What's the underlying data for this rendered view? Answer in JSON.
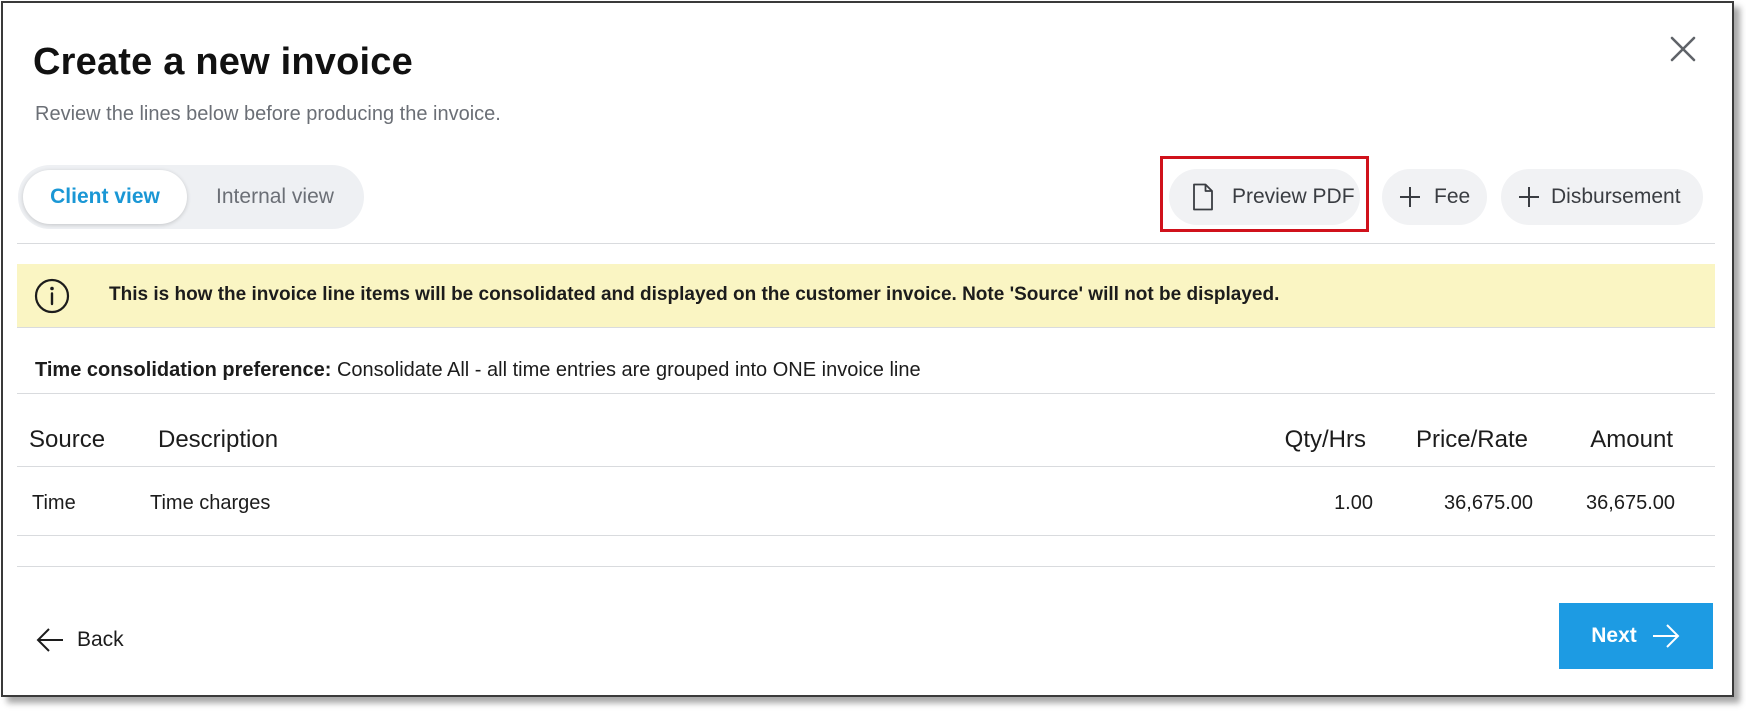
{
  "dialog": {
    "title": "Create a new invoice",
    "subtitle": "Review the lines below before producing the invoice."
  },
  "view_toggle": {
    "options": [
      {
        "label": "Client view",
        "selected": true
      },
      {
        "label": "Internal view",
        "selected": false
      }
    ]
  },
  "actions": {
    "preview_pdf": "Preview PDF",
    "fee": "Fee",
    "disbursement": "Disbursement"
  },
  "banner": {
    "text": "This is how the invoice line items will be consolidated and displayed on the customer invoice. Note 'Source' will not be displayed.",
    "icon": "info-icon",
    "color": "#faf5c3"
  },
  "preference": {
    "label": "Time consolidation preference:",
    "value": "Consolidate All - all time entries are grouped into ONE invoice line"
  },
  "table": {
    "headers": {
      "source": "Source",
      "description": "Description",
      "qty": "Qty/Hrs",
      "price": "Price/Rate",
      "amount": "Amount"
    },
    "rows": [
      {
        "source": "Time",
        "description": "Time charges",
        "qty": "1.00",
        "price": "36,675.00",
        "amount": "36,675.00"
      }
    ]
  },
  "footer": {
    "back": "Back",
    "next": "Next"
  },
  "colors": {
    "accent": "#1d9be3",
    "highlight": "#d0111b"
  }
}
